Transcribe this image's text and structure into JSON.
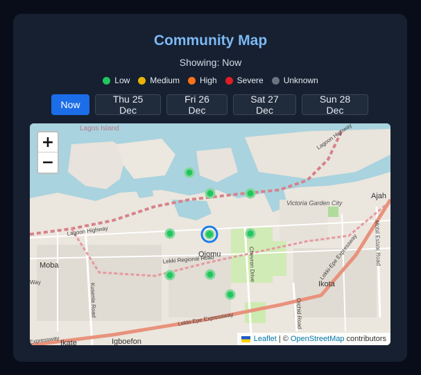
{
  "header": {
    "title": "Community Map",
    "showing": "Showing: Now"
  },
  "legend": [
    {
      "label": "Low",
      "color": "#22c55e"
    },
    {
      "label": "Medium",
      "color": "#eab308"
    },
    {
      "label": "High",
      "color": "#f97316"
    },
    {
      "label": "Severe",
      "color": "#e11d24"
    },
    {
      "label": "Unknown",
      "color": "#6b7280"
    }
  ],
  "tabs": [
    {
      "label": "Now",
      "active": true
    },
    {
      "label": "Thu 25 Dec"
    },
    {
      "label": "Fri 26 Dec"
    },
    {
      "label": "Sat 27 Dec"
    },
    {
      "label": "Sun 28 Dec"
    }
  ],
  "map": {
    "zoom_in": "+",
    "zoom_out": "−",
    "place_labels": [
      "Lagos Island",
      "Ajah",
      "Victoria Garden City",
      "Moba",
      "Ojomu",
      "Ikota",
      "Igboefon",
      "Ikate"
    ],
    "road_labels": [
      "Lagoon Highway",
      "Lagoon Highway",
      "Lekki Regional Road",
      "Lekki-Epe Expressway",
      "Lekki-Epe Expressway",
      "Kusenla Road",
      "Chevron Drive",
      "Orchid Road",
      "Mobil Estate Road",
      "Expressway",
      "Way"
    ],
    "attribution": {
      "leaflet": "Leaflet",
      "separator": "| ©",
      "osm": "OpenStreetMap",
      "suffix": "contributors"
    }
  }
}
